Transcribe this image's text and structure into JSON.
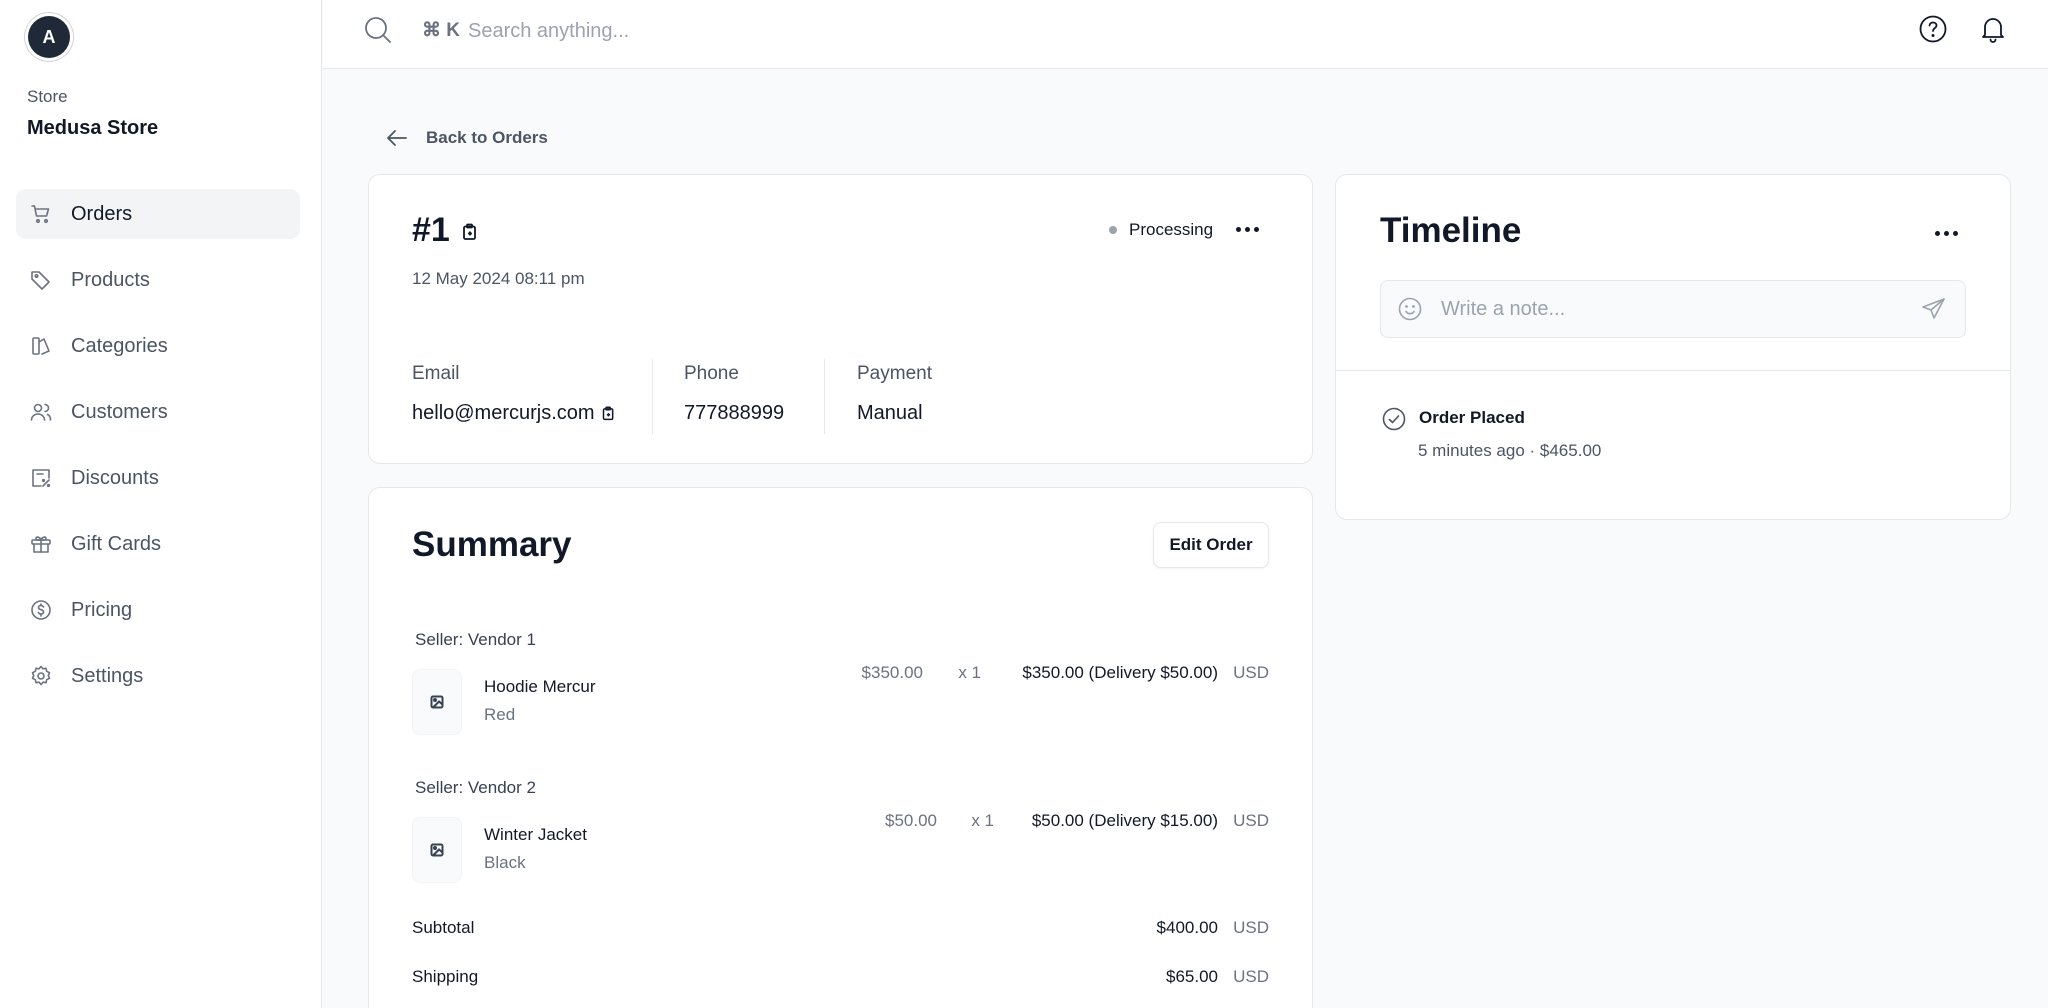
{
  "sidebar": {
    "avatar_letter": "A",
    "store_caption": "Store",
    "store_name": "Medusa Store",
    "items": [
      {
        "label": "Orders",
        "icon": "cart-icon",
        "active": true
      },
      {
        "label": "Products",
        "icon": "tag-icon"
      },
      {
        "label": "Categories",
        "icon": "categories-icon"
      },
      {
        "label": "Customers",
        "icon": "users-icon"
      },
      {
        "label": "Discounts",
        "icon": "discount-icon"
      },
      {
        "label": "Gift Cards",
        "icon": "gift-icon"
      },
      {
        "label": "Pricing",
        "icon": "dollar-icon"
      },
      {
        "label": "Settings",
        "icon": "gear-icon"
      }
    ]
  },
  "topbar": {
    "shortcut": "⌘ K",
    "search_placeholder": "Search anything...",
    "icons": [
      "help-icon",
      "bell-icon"
    ]
  },
  "back_link": "Back to Orders",
  "order": {
    "number": "#1",
    "date": "12 May 2024 08:11 pm",
    "status": "Processing",
    "email_label": "Email",
    "email": "hello@mercurjs.com",
    "phone_label": "Phone",
    "phone": "777888999",
    "payment_label": "Payment",
    "payment": "Manual"
  },
  "summary": {
    "title": "Summary",
    "edit_button": "Edit Order",
    "groups": [
      {
        "seller": "Seller: Vendor 1",
        "item": {
          "name": "Hoodie Mercur",
          "variant": "Red",
          "unit_price": "$350.00",
          "qty": "x 1",
          "total": "$350.00 (Delivery $50.00)",
          "currency": "USD"
        }
      },
      {
        "seller": "Seller: Vendor 2",
        "item": {
          "name": "Winter Jacket",
          "variant": "Black",
          "unit_price": "$50.00",
          "qty": "x 1",
          "total": "$50.00 (Delivery $15.00)",
          "currency": "USD"
        }
      }
    ],
    "totals": [
      {
        "label": "Subtotal",
        "value": "$400.00",
        "currency": "USD"
      },
      {
        "label": "Shipping",
        "value": "$65.00",
        "currency": "USD"
      }
    ]
  },
  "timeline": {
    "title": "Timeline",
    "note_placeholder": "Write a note...",
    "events": [
      {
        "title": "Order Placed",
        "meta": "5 minutes ago · $465.00"
      }
    ]
  }
}
